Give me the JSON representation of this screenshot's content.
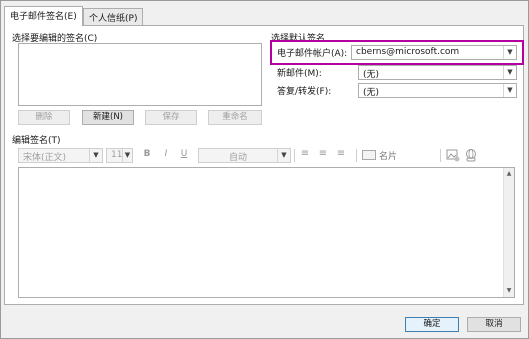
{
  "tabs": [
    {
      "label": "电子邮件签名(E)"
    },
    {
      "label": "个人信纸(P)"
    }
  ],
  "edit_section": {
    "label": "选择要编辑的签名(C)",
    "buttons": {
      "delete": "删除",
      "new": "新建(N)",
      "save": "保存",
      "rename": "重命名"
    }
  },
  "default_section": {
    "label": "选择默认签名",
    "email_account_label": "电子邮件帐户(A):",
    "email_account_value": "cberns@microsoft.com",
    "new_messages_label": "新邮件(M):",
    "new_messages_value": "(无)",
    "replies_label": "答复/转发(F):",
    "replies_value": "(无)"
  },
  "editor_section": {
    "label": "编辑签名(T)",
    "toolbar": {
      "font": "宋体(正文)",
      "size": "11",
      "bold": "B",
      "italic": "I",
      "underline": "U",
      "color": "自动",
      "business_card": "名片"
    }
  },
  "footer": {
    "ok": "确定",
    "cancel": "取消"
  },
  "colors": {
    "highlight": "#b4009e",
    "dialog_bg": "#f0f0f0"
  }
}
